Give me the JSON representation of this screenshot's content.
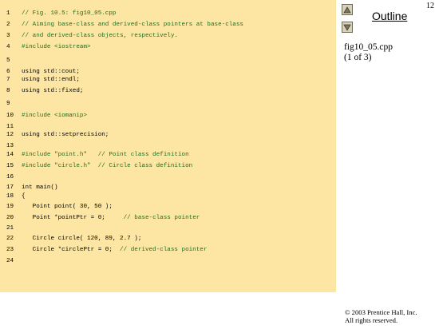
{
  "slide_number": "12",
  "outline": {
    "title": "Outline",
    "filename": "fig10_05.cpp",
    "page_info": "(1 of 3)",
    "up_icon": "triangle-up",
    "down_icon": "triangle-down"
  },
  "code_lines": [
    {
      "n": "1",
      "text": "// Fig. 10.5: fig10_05.cpp",
      "kind": "comment"
    },
    {
      "n": "2",
      "text": "// Aiming base-class and derived-class pointers at base-class",
      "kind": "comment"
    },
    {
      "n": "3",
      "text": "// and derived-class objects, respectively.",
      "kind": "comment"
    },
    {
      "n": "4",
      "text": "#include <iostream>",
      "kind": "pp"
    },
    {
      "n": "5",
      "text": "",
      "kind": "plain"
    },
    {
      "n": "6",
      "text": "using std::cout;",
      "kind": "plain"
    },
    {
      "n": "7",
      "text": "using std::endl;",
      "kind": "plain"
    },
    {
      "n": "8",
      "text": "using std::fixed;",
      "kind": "plain"
    },
    {
      "n": "9",
      "text": "",
      "kind": "plain"
    },
    {
      "n": "10",
      "text": "#include <iomanip>",
      "kind": "pp"
    },
    {
      "n": "11",
      "text": "",
      "kind": "plain"
    },
    {
      "n": "12",
      "text": "using std::setprecision;",
      "kind": "plain"
    },
    {
      "n": "13",
      "text": "",
      "kind": "plain"
    },
    {
      "n": "14",
      "text": "#include \"point.h\"   // Point class definition",
      "kind": "pp"
    },
    {
      "n": "15",
      "text": "#include \"circle.h\"  // Circle class definition",
      "kind": "pp"
    },
    {
      "n": "16",
      "text": "",
      "kind": "plain"
    },
    {
      "n": "17",
      "text": "int main()",
      "kind": "plain"
    },
    {
      "n": "18",
      "text": "{",
      "kind": "plain"
    },
    {
      "n": "19",
      "text": "   Point point( 30, 50 );",
      "kind": "plain"
    },
    {
      "n": "20",
      "text": "   Point *pointPtr = 0;     // base-class pointer",
      "kind": "mixed"
    },
    {
      "n": "21",
      "text": "",
      "kind": "plain"
    },
    {
      "n": "22",
      "text": "   Circle circle( 120, 89, 2.7 );",
      "kind": "plain"
    },
    {
      "n": "23",
      "text": "   Circle *circlePtr = 0;  // derived-class pointer",
      "kind": "mixed"
    },
    {
      "n": "24",
      "text": "",
      "kind": "plain"
    }
  ],
  "copyright": {
    "line1": "© 2003 Prentice Hall, Inc.",
    "line2": "All rights reserved."
  },
  "colors": {
    "code_background": "#fde6a3",
    "comment": "#1f6e1f"
  }
}
